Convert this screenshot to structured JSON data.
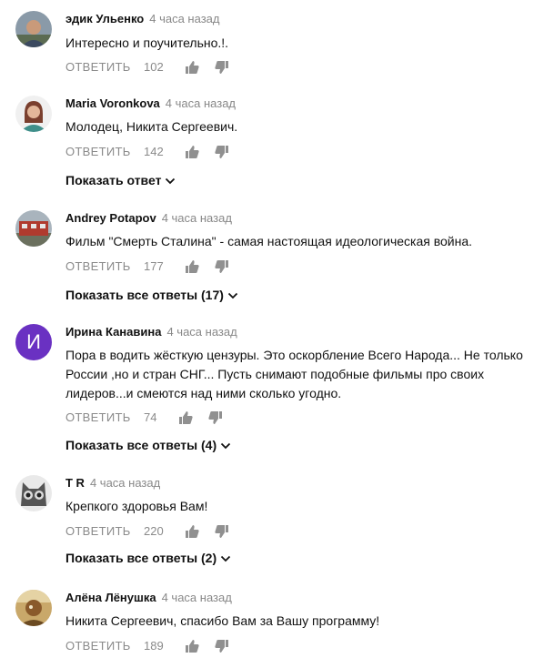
{
  "actions": {
    "reply_label": "ОТВЕТИТЬ"
  },
  "comments": [
    {
      "author": "эдик Ульенко",
      "time": "4 часа назад",
      "lines": [
        "Интересно и поучительно.!."
      ],
      "likes": "102",
      "replies": ""
    },
    {
      "author": "Maria Voronkova",
      "time": "4 часа назад",
      "lines": [
        "Молодец, Никита Сергеевич."
      ],
      "likes": "142",
      "replies": "Показать ответ"
    },
    {
      "author": "Andrey Potapov",
      "time": "4 часа назад",
      "lines": [
        "Фильм \"Смерть Сталина\" - самая настоящая идеологическая война."
      ],
      "likes": "177",
      "replies": "Показать все ответы (17)"
    },
    {
      "author": "Ирина Канавина",
      "time": "4 часа назад",
      "avatar_letter": "И",
      "lines": [
        "Пора в водить  жёсткую  цензуры. Это  оскорбление Всего Народа...  Не только",
        "России ,но и стран СНГ... Пусть снимают подобные фильмы про своих",
        "лидеров...и смеются над ними сколько угодно."
      ],
      "likes": "74",
      "replies": "Показать все ответы (4)"
    },
    {
      "author": "T R",
      "time": "4 часа назад",
      "lines": [
        "Крепкого здоровья Вам!"
      ],
      "likes": "220",
      "replies": "Показать все ответы (2)"
    },
    {
      "author": "Алёна Лёнушка",
      "time": "4 часа назад",
      "lines": [
        "Никита Сергеевич, спасибо Вам за Вашу программу!"
      ],
      "likes": "189",
      "replies": ""
    }
  ]
}
